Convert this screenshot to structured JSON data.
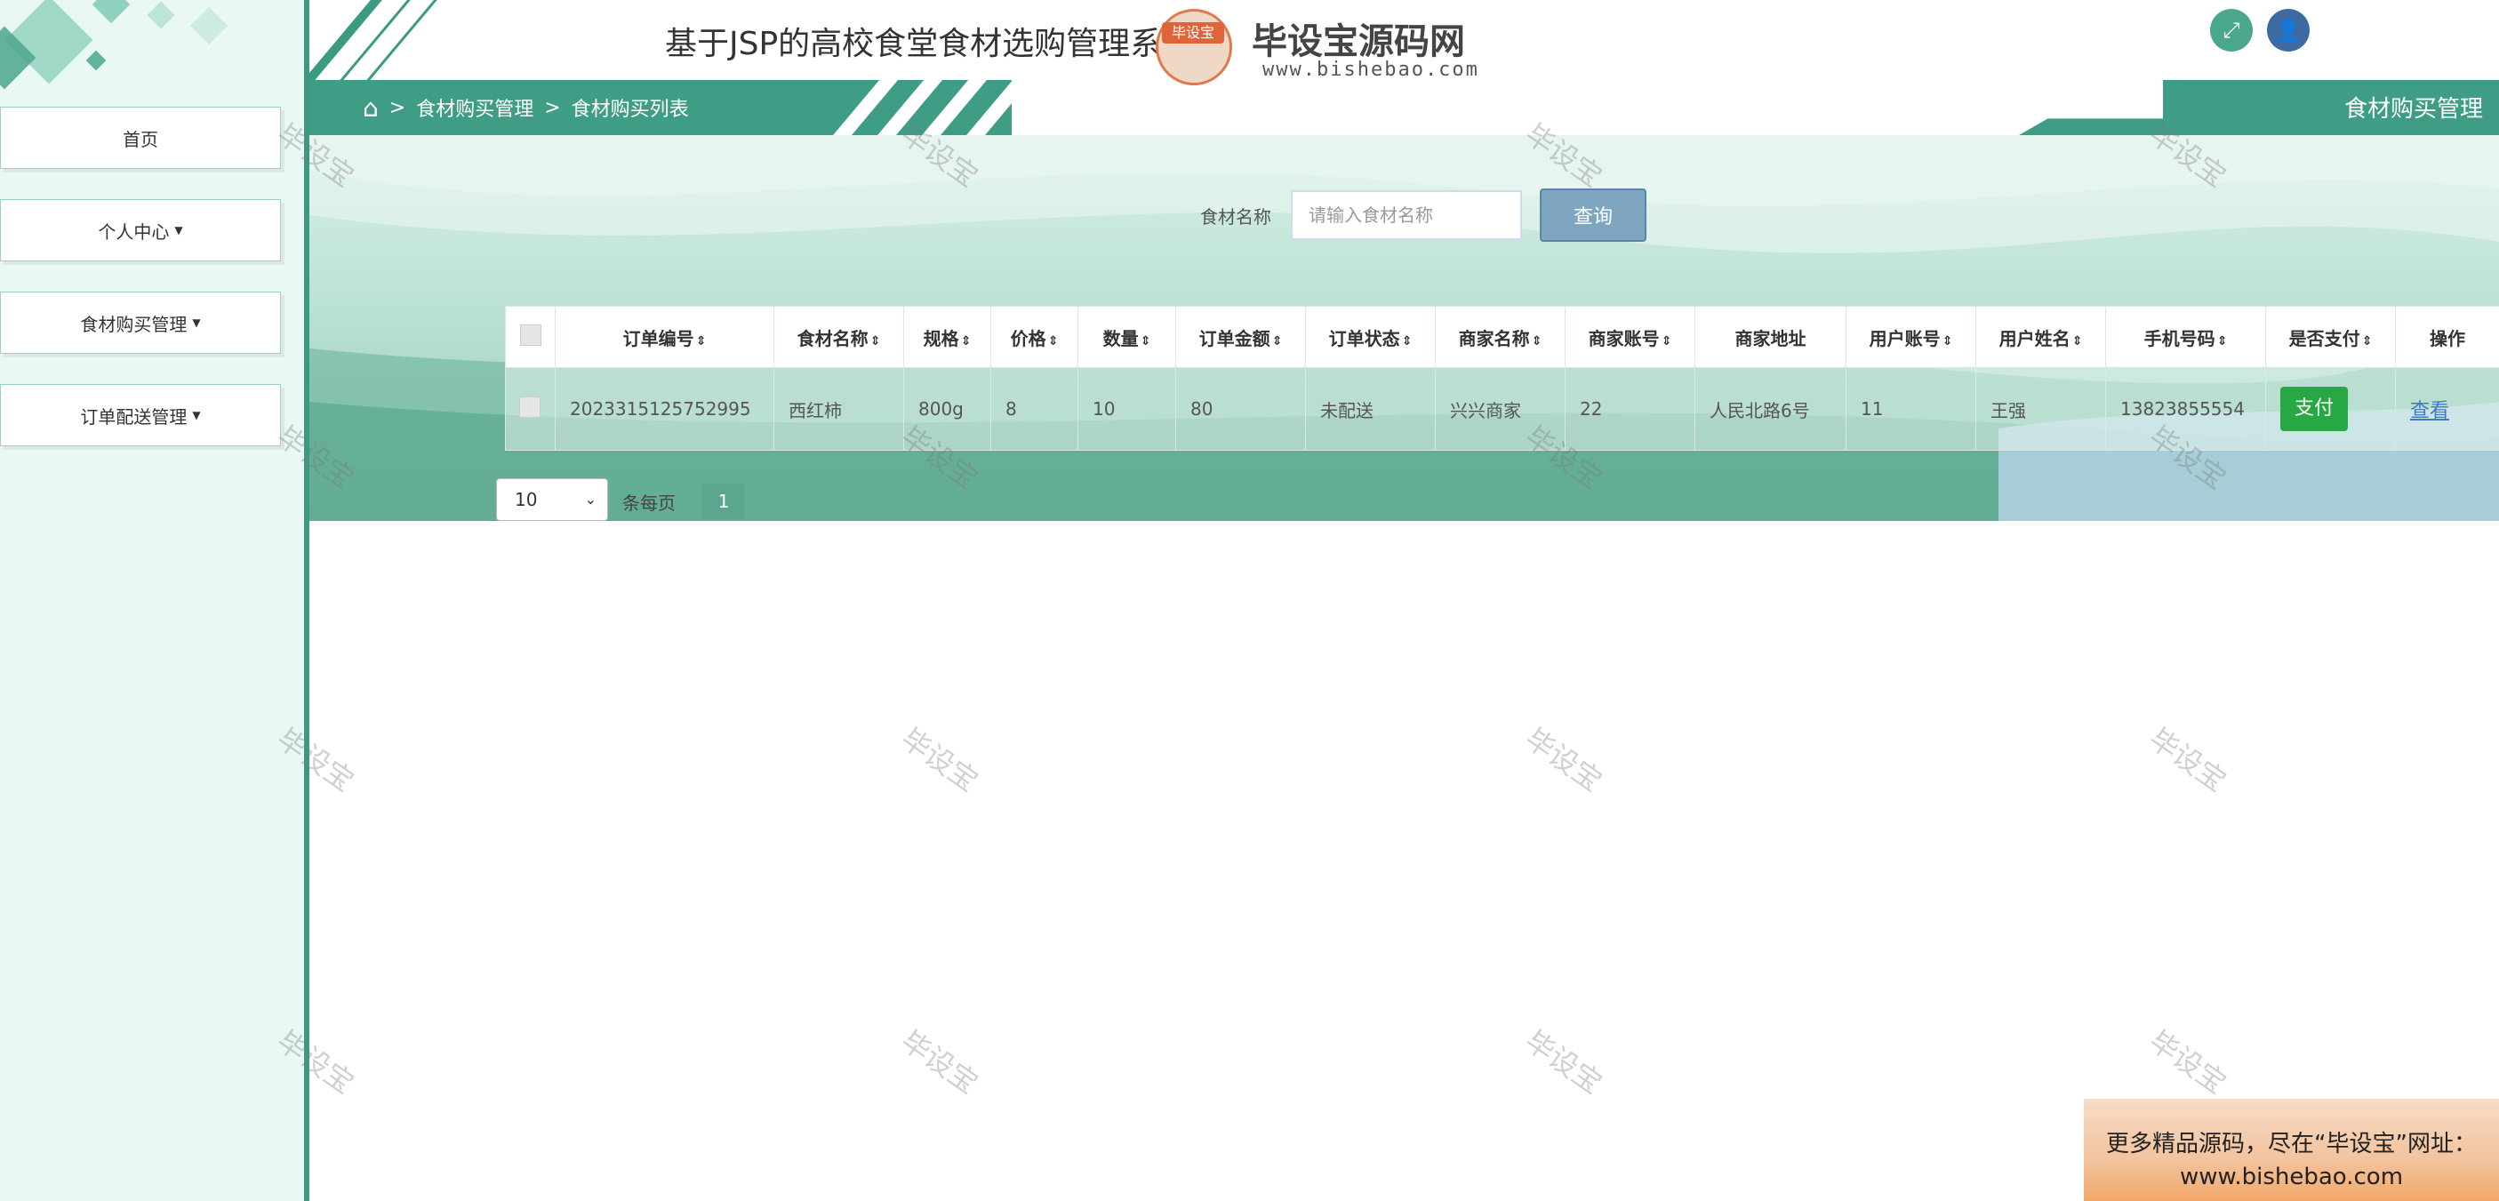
{
  "app": {
    "title": "基于JSP的高校食堂食材选购管理系统"
  },
  "logo_watermark": {
    "badge": "毕设宝",
    "big": "毕设宝源码网",
    "small": "www.bishebao.com"
  },
  "header_buttons": {
    "fullscreen_icon": "fullscreen-icon",
    "user_icon": "user-icon"
  },
  "sidebar": {
    "items": [
      {
        "label": "首页",
        "has_caret": false
      },
      {
        "label": "个人中心",
        "has_caret": true
      },
      {
        "label": "食材购买管理",
        "has_caret": true
      },
      {
        "label": "订单配送管理",
        "has_caret": true
      }
    ]
  },
  "breadcrumb": {
    "sep": ">",
    "items": [
      "食材购买管理",
      "食材购买列表"
    ]
  },
  "page_tag": "食材购买管理",
  "search": {
    "label": "食材名称",
    "placeholder": "请输入食材名称",
    "button": "查询"
  },
  "table": {
    "columns": [
      "订单编号",
      "食材名称",
      "规格",
      "价格",
      "数量",
      "订单金额",
      "订单状态",
      "商家名称",
      "商家账号",
      "商家地址",
      "用户账号",
      "用户姓名",
      "手机号码",
      "是否支付",
      "操作"
    ],
    "rows": [
      {
        "cells": [
          "2023315125752995",
          "西红柿",
          "800g",
          "8",
          "10",
          "80",
          "未配送",
          "兴兴商家",
          "22",
          "人民北路6号",
          "11",
          "王强",
          "13823855554"
        ],
        "pay_label": "支付",
        "view_label": "查看"
      }
    ]
  },
  "pagination": {
    "page_size": "10",
    "per_page_label": "条每页",
    "current_page": "1"
  },
  "watermark_text": "毕设宝",
  "banner": {
    "line1": "更多精品源码，尽在“毕设宝”网址：",
    "line2": "www.bishebao.com"
  },
  "colors": {
    "accent": "#3f9d85",
    "pay": "#28a745",
    "search_button": "#7fa6c0"
  }
}
